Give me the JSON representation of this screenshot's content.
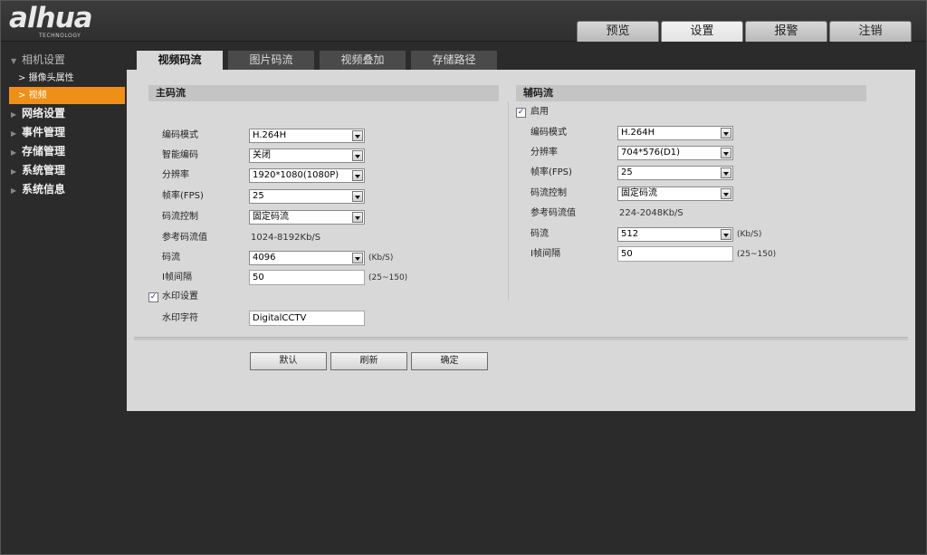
{
  "brand": {
    "logo": "alhua",
    "sub": "TECHNOLOGY"
  },
  "top_tabs": [
    "预览",
    "设置",
    "报警",
    "注销"
  ],
  "sidebar": {
    "camera_settings": "相机设置",
    "camera_props": "摄像头属性",
    "video": "视频",
    "network": "网络设置",
    "events": "事件管理",
    "storage": "存储管理",
    "system": "系统管理",
    "sysinfo": "系统信息"
  },
  "subtabs": [
    "视频码流",
    "图片码流",
    "视频叠加",
    "存储路径"
  ],
  "main": {
    "title": "主码流",
    "encode_mode_label": "编码模式",
    "encode_mode": "H.264H",
    "smart_label": "智能编码",
    "smart": "关闭",
    "resolution_label": "分辨率",
    "resolution": "1920*1080(1080P)",
    "fps_label": "帧率(FPS)",
    "fps": "25",
    "bitrate_ctrl_label": "码流控制",
    "bitrate_ctrl": "固定码流",
    "ref_bitrate_label": "参考码流值",
    "ref_bitrate": "1024-8192Kb/S",
    "bitrate_label": "码流",
    "bitrate": "4096",
    "bitrate_unit": "(Kb/S)",
    "iframe_label": "I帧间隔",
    "iframe": "50",
    "iframe_range": "(25~150)",
    "watermark_label": "水印设置",
    "watermark_text_label": "水印字符",
    "watermark_text": "DigitalCCTV"
  },
  "sub": {
    "title": "辅码流",
    "enable_label": "启用",
    "encode_mode_label": "编码模式",
    "encode_mode": "H.264H",
    "resolution_label": "分辨率",
    "resolution": "704*576(D1)",
    "fps_label": "帧率(FPS)",
    "fps": "25",
    "bitrate_ctrl_label": "码流控制",
    "bitrate_ctrl": "固定码流",
    "ref_bitrate_label": "参考码流值",
    "ref_bitrate": "224-2048Kb/S",
    "bitrate_label": "码流",
    "bitrate": "512",
    "bitrate_unit": "(Kb/S)",
    "iframe_label": "I帧间隔",
    "iframe": "50",
    "iframe_range": "(25~150)"
  },
  "buttons": {
    "default": "默认",
    "refresh": "刷新",
    "ok": "确定"
  },
  "check_mark": "✓"
}
